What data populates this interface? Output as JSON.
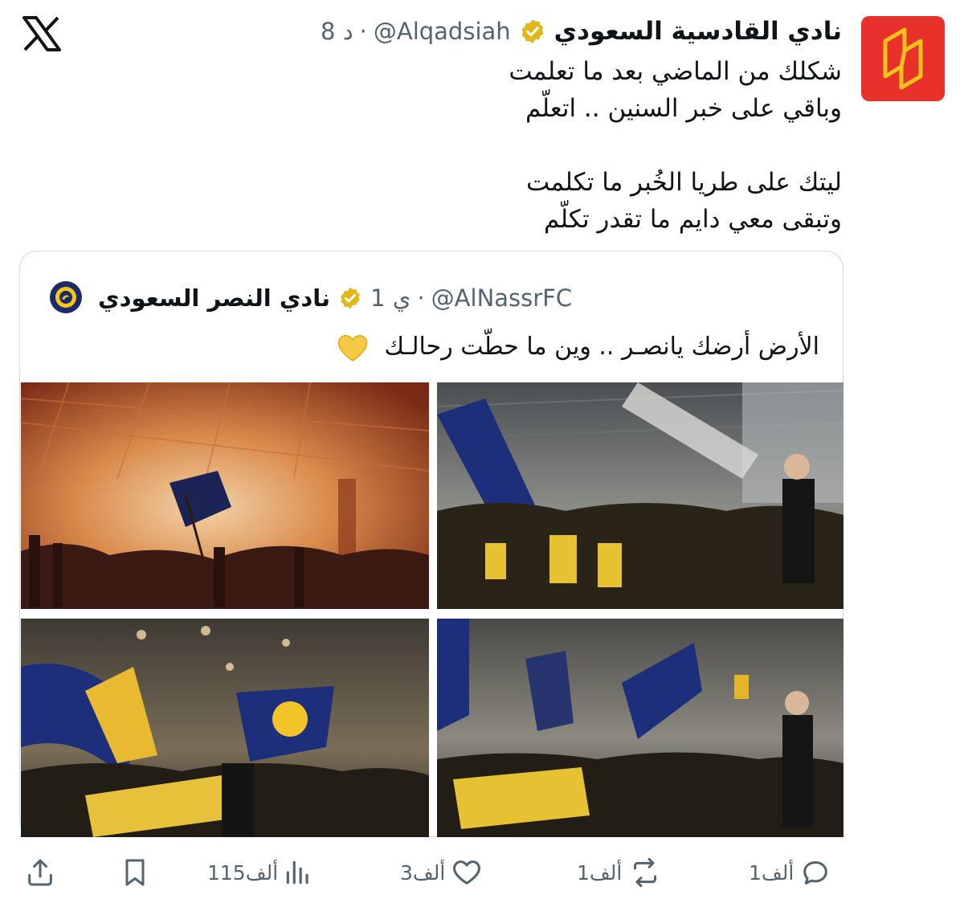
{
  "author": {
    "display_name": "نادي القادسية السعودي",
    "handle": "@Alqadsiah",
    "time": "8 د",
    "avatar_color": "#e8312a"
  },
  "tweet": {
    "lines": [
      "شكلك من الماضي بعد ما تعلمت",
      "وباقي على خبر السنين .. اتعلّم",
      "ليتك على طريا الخُبر ما تكلمت",
      "وتبقى معي دايم ما تقدر تكلّم"
    ]
  },
  "quoted": {
    "display_name": "نادي النصر السعودي",
    "handle": "@AlNassrFC",
    "time": "1 ي",
    "text": "الأرض أرضك يانصـر .. وين ما حطّت رحالـك"
  },
  "actions": {
    "replies": "1ألف",
    "reposts": "1ألف",
    "likes": "3ألف",
    "views": "115ألف"
  },
  "colors": {
    "verified_gold": "#e2b719",
    "muted": "#536471",
    "border": "#cfd9de"
  }
}
